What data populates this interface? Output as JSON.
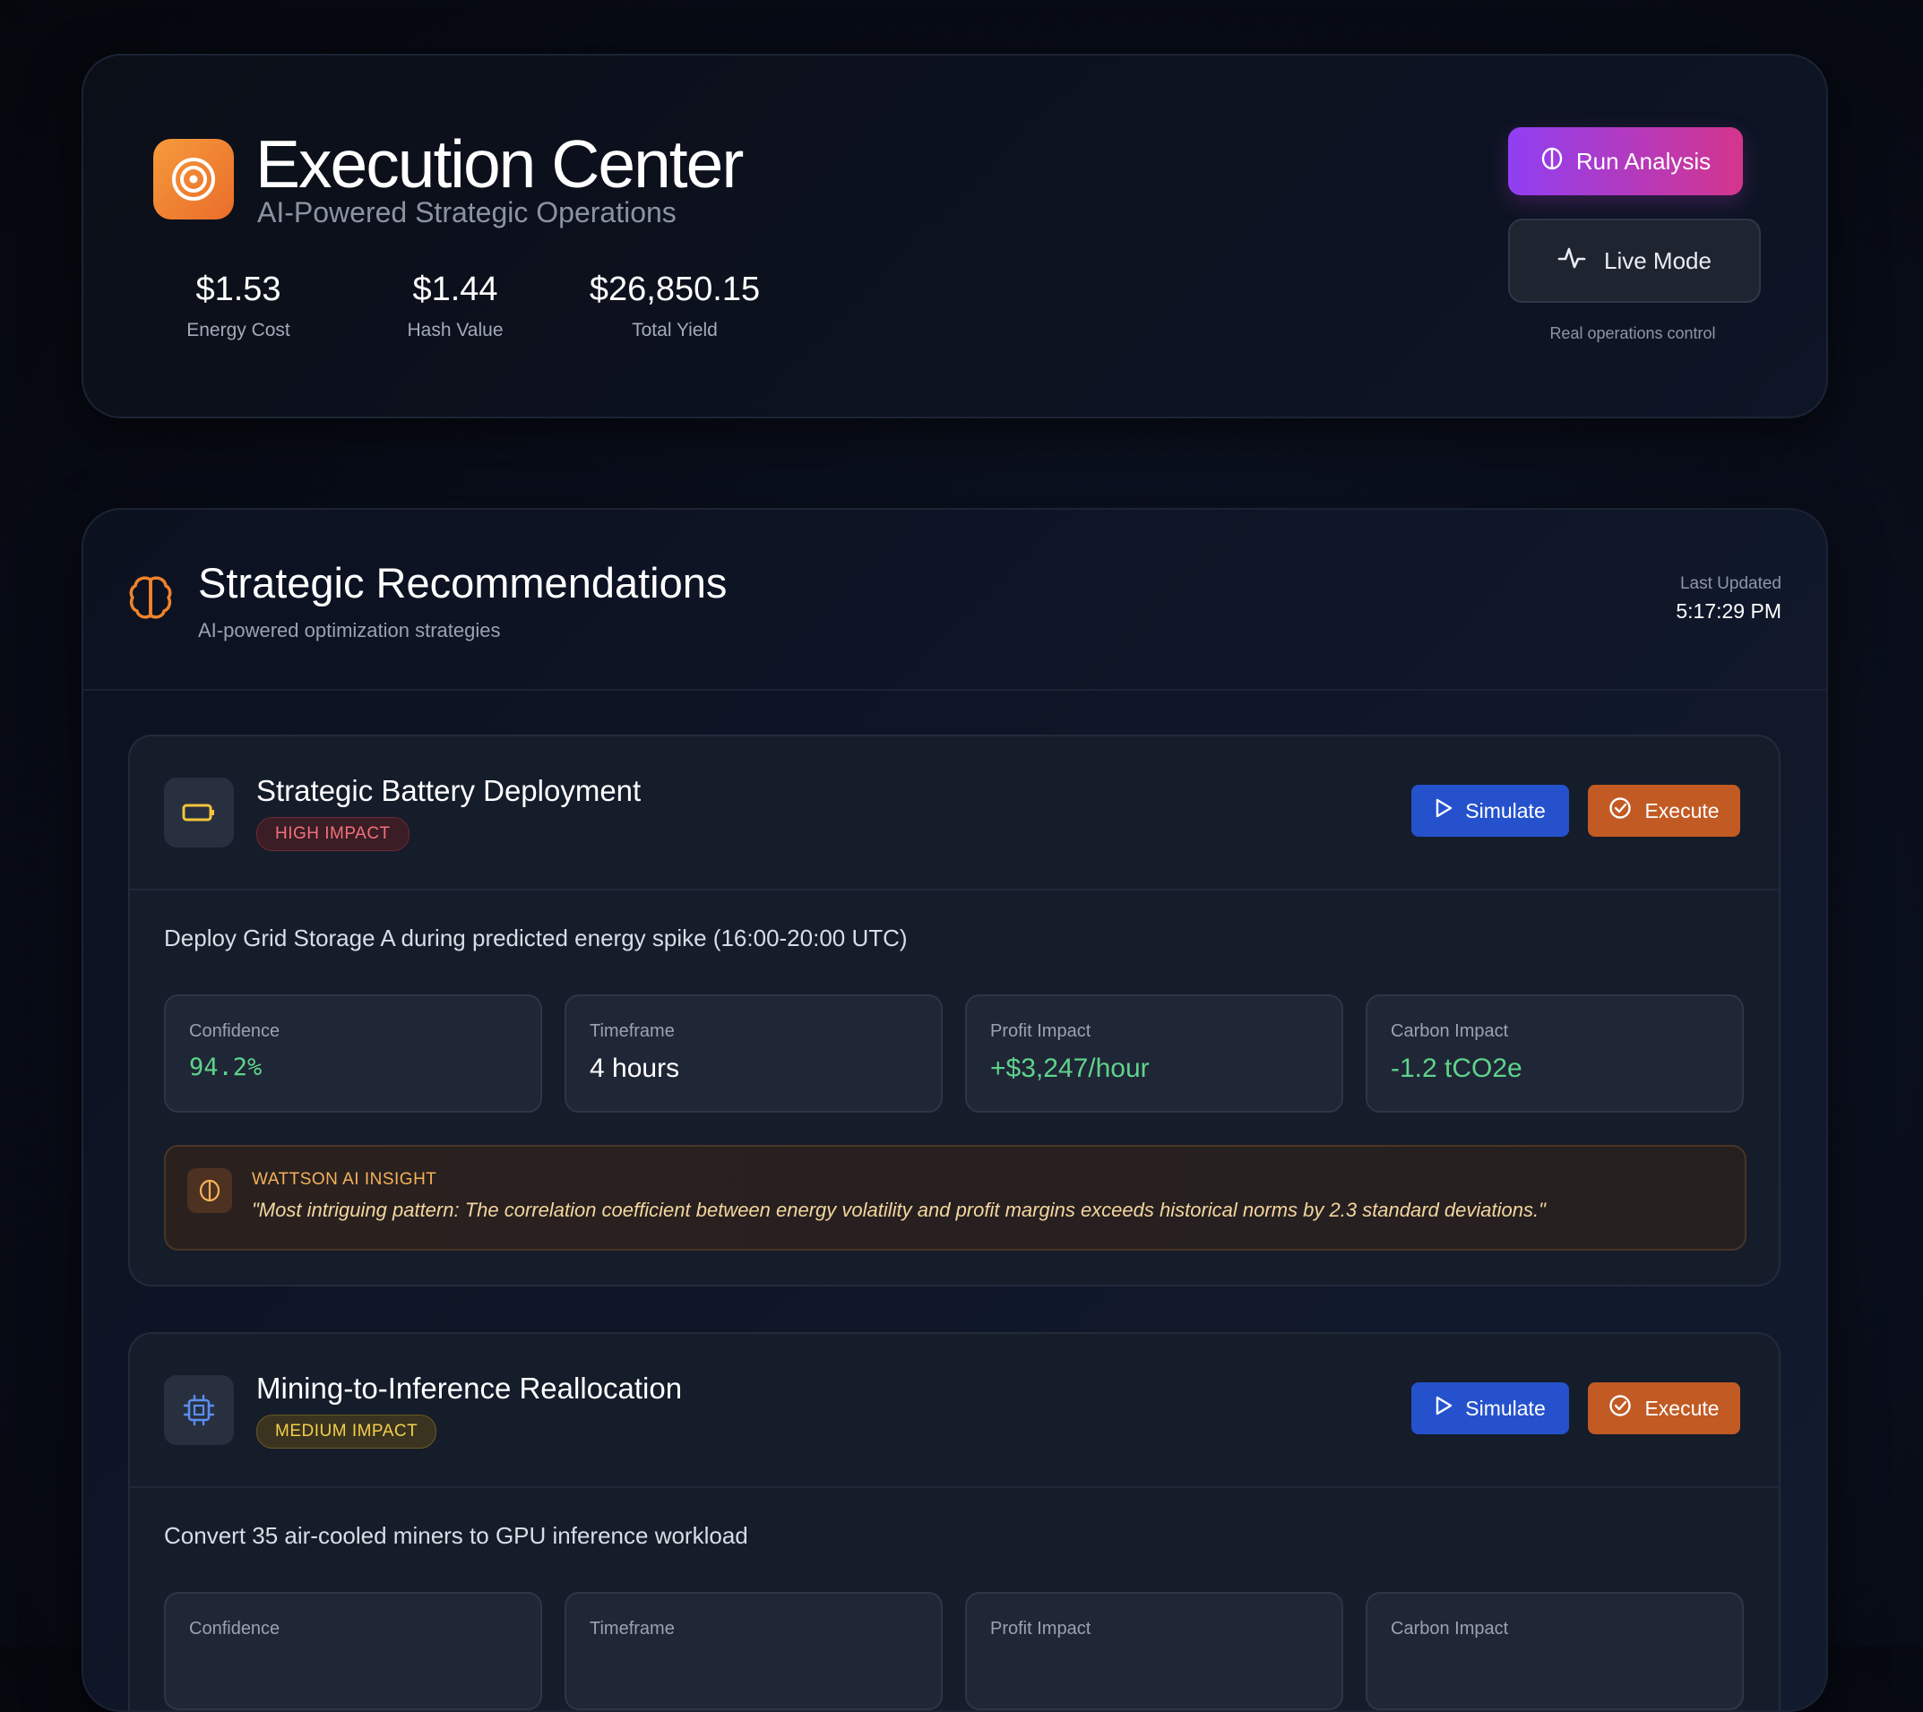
{
  "hero": {
    "title": "Execution Center",
    "subtitle": "AI-Powered Strategic Operations",
    "stats": [
      {
        "value": "$1.53",
        "label": "Energy Cost"
      },
      {
        "value": "$1.44",
        "label": "Hash Value"
      },
      {
        "value": "$26,850.15",
        "label": "Total Yield"
      }
    ],
    "run_analysis_label": "Run Analysis",
    "live_mode_label": "Live Mode",
    "live_caption": "Real operations control"
  },
  "recommendations": {
    "title": "Strategic Recommendations",
    "subtitle": "AI-powered optimization strategies",
    "last_updated_label": "Last Updated",
    "last_updated_time": "5:17:29 PM",
    "cards": [
      {
        "icon": "battery-icon",
        "title": "Strategic Battery Deployment",
        "impact": "HIGH IMPACT",
        "simulate_label": "Simulate",
        "execute_label": "Execute",
        "description": "Deploy Grid Storage A during predicted energy spike (16:00-20:00 UTC)",
        "metrics": [
          {
            "label": "Confidence",
            "value": "94.2%"
          },
          {
            "label": "Timeframe",
            "value": "4 hours"
          },
          {
            "label": "Profit Impact",
            "value": "+$3,247/hour"
          },
          {
            "label": "Carbon Impact",
            "value": "-1.2 tCO2e"
          }
        ],
        "insight_label": "WATTSON AI INSIGHT",
        "insight_quote": "\"Most intriguing pattern: The correlation coefficient between energy volatility and profit margins exceeds historical norms by 2.3 standard deviations.\""
      },
      {
        "icon": "cpu-icon",
        "title": "Mining-to-Inference Reallocation",
        "impact": "MEDIUM IMPACT",
        "simulate_label": "Simulate",
        "execute_label": "Execute",
        "description": "Convert 35 air-cooled miners to GPU inference workload",
        "metrics": [
          {
            "label": "Confidence"
          },
          {
            "label": "Timeframe"
          },
          {
            "label": "Profit Impact"
          },
          {
            "label": "Carbon Impact"
          }
        ]
      }
    ]
  },
  "colors": {
    "accent_orange": "#ea6d2a",
    "run_gradient_start": "#8f3ff3",
    "run_gradient_end": "#d4358d",
    "simulate_blue": "#2552cc",
    "execute_orange": "#c25a24",
    "positive_green": "#5fd38a",
    "high_impact_red": "#f2717a",
    "medium_impact_yellow": "#f3cf4a"
  }
}
